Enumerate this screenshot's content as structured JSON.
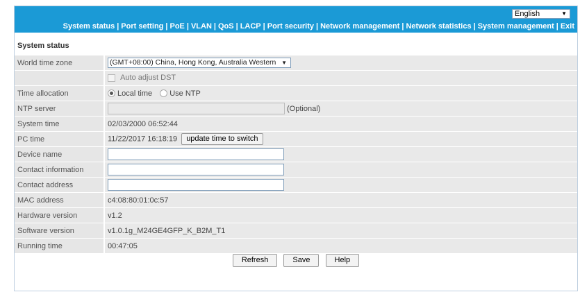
{
  "header": {
    "language": "English",
    "nav": [
      "System status",
      "Port setting",
      "PoE",
      "VLAN",
      "QoS",
      "LACP",
      "Port security",
      "Network management",
      "Network statistics",
      "System management",
      "Exit"
    ]
  },
  "section_title": "System status",
  "form": {
    "world_time_zone": {
      "label": "World time zone",
      "value": "(GMT+08:00) China, Hong Kong, Australia Western"
    },
    "auto_dst": {
      "label": "Auto adjust DST",
      "checked": false
    },
    "time_allocation": {
      "label": "Time allocation",
      "options": [
        "Local time",
        "Use NTP"
      ],
      "selected": "Local time"
    },
    "ntp_server": {
      "label": "NTP server",
      "value": "",
      "note": "(Optional)"
    },
    "system_time": {
      "label": "System time",
      "value": "02/03/2000 06:52:44"
    },
    "pc_time": {
      "label": "PC time",
      "value": "11/22/2017 16:18:19",
      "button": "update time to switch"
    },
    "device_name": {
      "label": "Device name",
      "value": ""
    },
    "contact_information": {
      "label": "Contact information",
      "value": ""
    },
    "contact_address": {
      "label": "Contact address",
      "value": ""
    },
    "mac_address": {
      "label": "MAC address",
      "value": "c4:08:80:01:0c:57"
    },
    "hardware_version": {
      "label": "Hardware version",
      "value": "v1.2"
    },
    "software_version": {
      "label": "Software version",
      "value": "v1.0.1g_M24GE4GFP_K_B2M_T1"
    },
    "running_time": {
      "label": "Running time",
      "value": "00:47:05"
    }
  },
  "buttons": {
    "refresh": "Refresh",
    "save": "Save",
    "help": "Help"
  },
  "colors": {
    "header_bg": "#1b9ad6",
    "row_bg": "#e6e6e6"
  }
}
